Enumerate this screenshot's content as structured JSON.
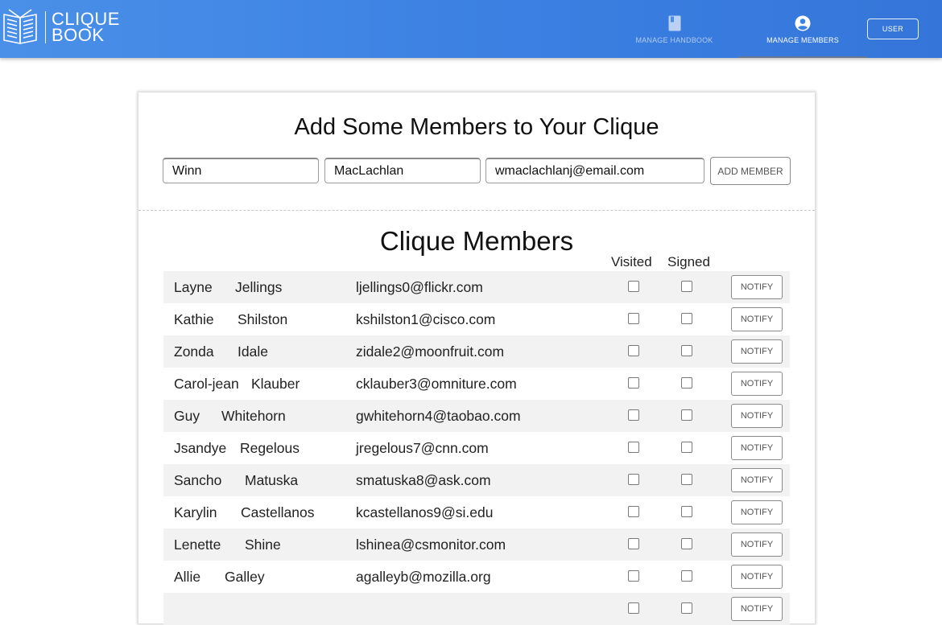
{
  "header": {
    "logo": {
      "line1": "CLIQUE",
      "line2": "BOOK",
      "icon": "open-book-icon"
    },
    "nav": [
      {
        "label": "MANAGE HANDBOOK",
        "icon": "book-icon"
      },
      {
        "label": "MANAGE MEMBERS",
        "icon": "account-circle-icon",
        "active": true
      }
    ],
    "user_label": "USER",
    "colors": {
      "bar_start": "#4a90e8",
      "bar_end": "#3575d9"
    }
  },
  "add_form": {
    "title": "Add Some Members to Your Clique",
    "first_name": "Winn",
    "last_name": "MacLachlan",
    "email": "wmaclachlanj@email.com",
    "button_label": "ADD MEMBER"
  },
  "members": {
    "title": "Clique Members",
    "columns": {
      "visited": "Visited",
      "signed": "Signed"
    },
    "notify_label": "NOTIFY",
    "rows": [
      {
        "first": "Layne",
        "last": "Jellings",
        "email": "ljellings0@flickr.com",
        "visited": false,
        "signed": false
      },
      {
        "first": "Kathie",
        "last": "Shilston",
        "email": "kshilston1@cisco.com",
        "visited": false,
        "signed": false
      },
      {
        "first": "Zonda",
        "last": "Idale",
        "email": "zidale2@moonfruit.com",
        "visited": false,
        "signed": false
      },
      {
        "first": "Carol-jean",
        "last": "Klauber",
        "email": "cklauber3@omniture.com",
        "visited": false,
        "signed": false
      },
      {
        "first": "Guy",
        "last": "Whitehorn",
        "email": "gwhitehorn4@taobao.com",
        "visited": false,
        "signed": false
      },
      {
        "first": "Jsandye",
        "last": "Regelous",
        "email": "jregelous7@cnn.com",
        "visited": false,
        "signed": false
      },
      {
        "first": "Sancho",
        "last": "Matuska",
        "email": "smatuska8@ask.com",
        "visited": false,
        "signed": false
      },
      {
        "first": "Karylin",
        "last": "Castellanos",
        "email": "kcastellanos9@si.edu",
        "visited": false,
        "signed": false
      },
      {
        "first": "Lenette",
        "last": "Shine",
        "email": "lshinea@csmonitor.com",
        "visited": false,
        "signed": false
      },
      {
        "first": "Allie",
        "last": "Galley",
        "email": "agalleyb@mozilla.org",
        "visited": false,
        "signed": false
      },
      {
        "first": "",
        "last": "",
        "email": "",
        "visited": false,
        "signed": false
      }
    ]
  }
}
